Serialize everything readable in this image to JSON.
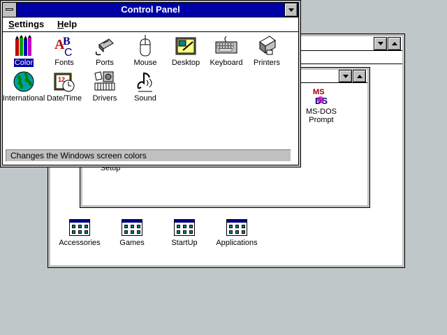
{
  "control_panel": {
    "title": "Control Panel",
    "menu": [
      {
        "label_prefix": "S",
        "label_rest": "ettings"
      },
      {
        "label_prefix": "H",
        "label_rest": "elp"
      }
    ],
    "icons": [
      {
        "label": "Color",
        "icon": "color-icon"
      },
      {
        "label": "Fonts",
        "icon": "fonts-icon"
      },
      {
        "label": "Ports",
        "icon": "ports-icon"
      },
      {
        "label": "Mouse",
        "icon": "mouse-icon"
      },
      {
        "label": "Desktop",
        "icon": "desktop-icon"
      },
      {
        "label": "Keyboard",
        "icon": "keyboard-icon"
      },
      {
        "label": "Printers",
        "icon": "printers-icon"
      },
      {
        "label": "International",
        "icon": "international-icon"
      },
      {
        "label": "Date/Time",
        "icon": "date-time-icon"
      },
      {
        "label": "Drivers",
        "icon": "drivers-icon"
      },
      {
        "label": "Sound",
        "icon": "sound-icon"
      }
    ],
    "status": "Changes the Windows screen colors"
  },
  "main_group": {
    "items": [
      {
        "label": "MS-DOS",
        "label2": "Prompt",
        "icon": "ms-dos-icon"
      },
      {
        "label": "Setup",
        "icon": "setup-icon"
      }
    ],
    "msdos_text": "MS DOS"
  },
  "program_groups": [
    {
      "label": "Accessories",
      "icon": "program-group-icon"
    },
    {
      "label": "Games",
      "icon": "program-group-icon"
    },
    {
      "label": "StartUp",
      "icon": "program-group-icon"
    },
    {
      "label": "Applications",
      "icon": "program-group-icon"
    }
  ],
  "colors": {
    "desktop": "#c0c7c8",
    "active_title": "#0000a8",
    "window": "#ffffff"
  }
}
